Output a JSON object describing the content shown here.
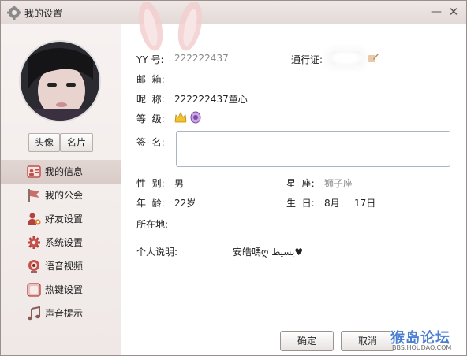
{
  "window": {
    "title": "我的设置",
    "minimize_glyph": "—",
    "close_glyph": "✕"
  },
  "profile": {
    "avatar_button": "头像",
    "card_button": "名片"
  },
  "nav": {
    "items": [
      {
        "label": "我的信息",
        "icon": "user-info-icon"
      },
      {
        "label": "我的公会",
        "icon": "flag-icon"
      },
      {
        "label": "好友设置",
        "icon": "friend-settings-icon"
      },
      {
        "label": "系统设置",
        "icon": "gear-icon"
      },
      {
        "label": "语音视频",
        "icon": "webcam-icon"
      },
      {
        "label": "热键设置",
        "icon": "hotkey-icon"
      },
      {
        "label": "声音提示",
        "icon": "music-note-icon"
      }
    ],
    "active_index": 0
  },
  "info": {
    "yy_label": "YY 号:",
    "yy_value": "222222437",
    "passport_label": "通行证:",
    "email_label": "邮  箱:",
    "nickname_label": "昵  称:",
    "nickname_value": "222222437童心",
    "level_label": "等  级:",
    "signature_label": "签  名:",
    "signature_value": "",
    "gender_label": "性  别:",
    "gender_value": "男",
    "zodiac_label": "星  座:",
    "zodiac_value": "狮子座",
    "age_label": "年  龄:",
    "age_value": "22岁",
    "birthday_label": "生  日:",
    "birthday_month": "8月",
    "birthday_day": "17日",
    "location_label": "所在地:",
    "about_label": "个人说明:",
    "about_value": "安皓嗎ღ بسيط♥"
  },
  "footer": {
    "ok_label": "确定",
    "cancel_label": "取消"
  },
  "watermark": {
    "main": "猴岛论坛",
    "sub": "BBS.HOUDAO.COM"
  },
  "colors": {
    "accent": "#d9ccc8",
    "titlebar": "#e3d9d6"
  }
}
